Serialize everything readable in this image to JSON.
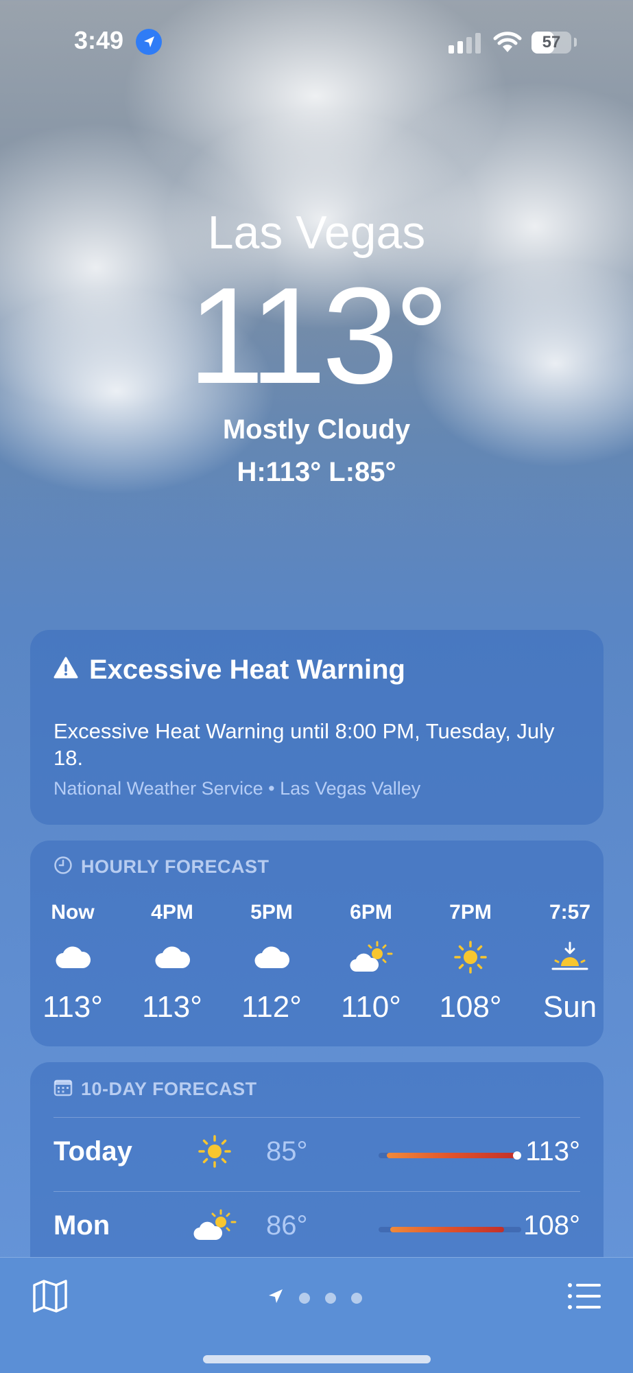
{
  "status_bar": {
    "time": "3:49",
    "battery": "57",
    "battery_fraction": 0.57
  },
  "current": {
    "city": "Las Vegas",
    "temperature": "113°",
    "condition": "Mostly Cloudy",
    "hi_lo": "H:113°  L:85°"
  },
  "warning": {
    "title": "Excessive Heat Warning",
    "body": "Excessive Heat Warning until 8:00 PM, Tuesday, July 18.",
    "source": "National Weather Service • Las Vegas Valley"
  },
  "hourly": {
    "label": "HOURLY FORECAST",
    "items": [
      {
        "hour": "Now",
        "icon": "cloud-icon",
        "temp": "113°"
      },
      {
        "hour": "4PM",
        "icon": "cloud-icon",
        "temp": "113°"
      },
      {
        "hour": "5PM",
        "icon": "cloud-icon",
        "temp": "112°"
      },
      {
        "hour": "6PM",
        "icon": "partly-sunny-icon",
        "temp": "110°"
      },
      {
        "hour": "7PM",
        "icon": "sun-icon",
        "temp": "108°"
      },
      {
        "hour": "7:57",
        "icon": "sunset-icon",
        "temp": "Sun"
      }
    ]
  },
  "daily": {
    "label": "10-DAY FORECAST",
    "items": [
      {
        "day": "Today",
        "icon": "sun-icon",
        "low": "85°",
        "high": "113°",
        "range_start": 0.06,
        "range_end": 0.97,
        "current": 0.97
      },
      {
        "day": "Mon",
        "icon": "partly-sunny-icon",
        "low": "86°",
        "high": "108°",
        "range_start": 0.08,
        "range_end": 0.88
      }
    ]
  },
  "colors": {
    "location_badge": "#2f7cf6",
    "sun": "#f7c62f",
    "heat_bar": "#e0532b"
  }
}
